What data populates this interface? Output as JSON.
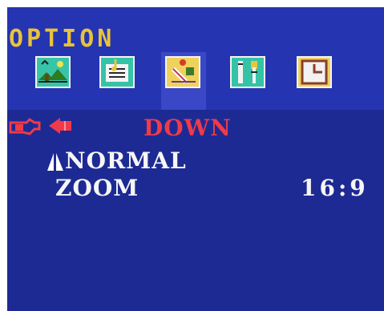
{
  "menu": {
    "title": "OPTION"
  },
  "tabs": [
    {
      "icon": "picture-icon",
      "active": false
    },
    {
      "icon": "document-sound-icon",
      "active": false
    },
    {
      "icon": "option-tools-icon",
      "active": true
    },
    {
      "icon": "tools-icon",
      "active": false
    },
    {
      "icon": "clock-icon",
      "active": false
    }
  ],
  "rows": {
    "selected": {
      "label": "DOWN",
      "pointer_icon": "hand-pointer-icon",
      "arrow_icon": "left-arrow-icon"
    },
    "mode": {
      "label": "NORMAL",
      "icon": "flip-icon"
    },
    "zoom": {
      "label": "ZOOM",
      "value": "16:9"
    }
  },
  "colors": {
    "background": "#2534b0",
    "content_background": "#1d2a93",
    "title": "#e8c33a",
    "highlight": "#f03a4a",
    "text": "#f6f6f6"
  }
}
